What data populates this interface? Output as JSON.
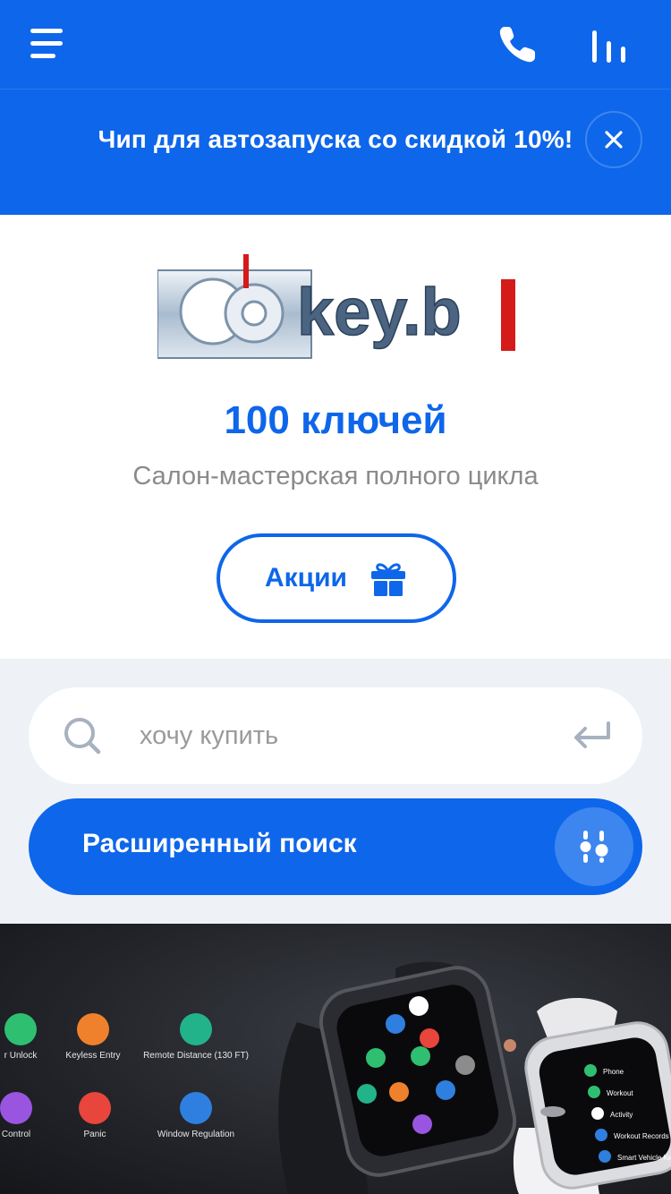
{
  "header": {
    "menu_icon": "hamburger-icon",
    "phone_icon": "phone-icon",
    "bars_icon": "bar-chart-icon"
  },
  "promo": {
    "text": "Чип для автозапуска со скидкой 10%!",
    "close_icon": "close-icon"
  },
  "brand": {
    "logo_text": "key.b",
    "title": "100 ключей",
    "subtitle": "Салон-мастерская полного цикла",
    "promo_button": "Акции",
    "promo_button_icon": "gift-icon"
  },
  "search": {
    "placeholder": "хочу купить",
    "search_icon": "search-icon",
    "enter_icon": "enter-icon",
    "advanced_label": "Расширенный поиск",
    "advanced_icon": "filter-sliders-icon"
  },
  "banner": {
    "features": [
      {
        "label": "r Unlock",
        "color": "#2fbf71"
      },
      {
        "label": "Keyless Entry",
        "color": "#f0812c"
      },
      {
        "label": "Remote Distance (130 FT)",
        "color": "#22b38a"
      },
      {
        "label": "Control",
        "color": "#9a55e0"
      },
      {
        "label": "Panic",
        "color": "#e8453c"
      },
      {
        "label": "Window Regulation",
        "color": "#2f7fe0"
      }
    ],
    "watch_labels": [
      "Phone",
      "Workout",
      "Activity",
      "Workout Records",
      "Smart Vehicle Key"
    ]
  },
  "colors": {
    "accent": "#0e66ea",
    "search_bg": "#eef2f7"
  }
}
